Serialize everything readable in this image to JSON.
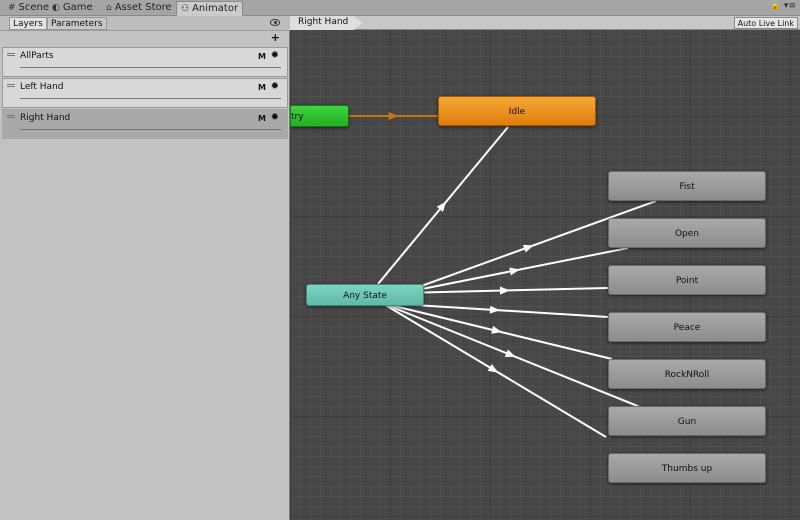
{
  "tabs": [
    {
      "label": "Scene",
      "icon": "scene-icon"
    },
    {
      "label": "Game",
      "icon": "game-icon"
    },
    {
      "label": "Asset Store",
      "icon": "asset-store-icon"
    },
    {
      "label": "Animator",
      "icon": "animator-icon"
    }
  ],
  "window_controls": "🔒 ▾≡",
  "left_panel": {
    "tabs": [
      {
        "label": "Layers"
      },
      {
        "label": "Parameters"
      }
    ],
    "add_label": "+",
    "layers": [
      {
        "name": "AllParts",
        "mask_label": "M"
      },
      {
        "name": "Left Hand",
        "mask_label": "M"
      },
      {
        "name": "Right Hand",
        "mask_label": "M"
      }
    ]
  },
  "graph": {
    "breadcrumb": "Right Hand",
    "live_link_label": "Auto Live Link",
    "states": {
      "entry": "try",
      "idle": "Idle",
      "any_state": "Any State",
      "targets": [
        "Fist",
        "Open",
        "Point",
        "Peace",
        "RockNRoll",
        "Gun",
        "Thumbs up"
      ]
    },
    "colors": {
      "idle": "#e88a16",
      "any_state": "#6fc6b4",
      "entry": "#2cc02c",
      "state": "#9a9a9a",
      "transition": "#ffffff",
      "entry_transition": "#c57212"
    }
  }
}
